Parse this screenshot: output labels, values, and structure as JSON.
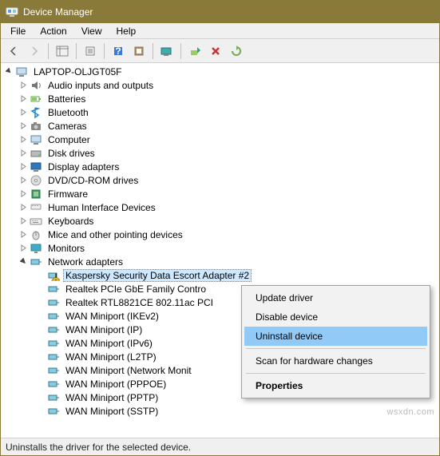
{
  "title": "Device Manager",
  "menus": {
    "file": "File",
    "action": "Action",
    "view": "View",
    "help": "Help"
  },
  "root": "LAPTOP-OLJGT05F",
  "cats": [
    "Audio inputs and outputs",
    "Batteries",
    "Bluetooth",
    "Cameras",
    "Computer",
    "Disk drives",
    "Display adapters",
    "DVD/CD-ROM drives",
    "Firmware",
    "Human Interface Devices",
    "Keyboards",
    "Mice and other pointing devices",
    "Monitors",
    "Network adapters"
  ],
  "net": {
    "selected": "Kaspersky Security Data Escort Adapter #2",
    "items": [
      "Realtek PCIe GbE Family Contro",
      "Realtek RTL8821CE 802.11ac PCI",
      "WAN Miniport (IKEv2)",
      "WAN Miniport (IP)",
      "WAN Miniport (IPv6)",
      "WAN Miniport (L2TP)",
      "WAN Miniport (Network Monit",
      "WAN Miniport (PPPOE)",
      "WAN Miniport (PPTP)",
      "WAN Miniport (SSTP)"
    ]
  },
  "ctx": {
    "update": "Update driver",
    "disable": "Disable device",
    "uninstall": "Uninstall device",
    "scan": "Scan for hardware changes",
    "props": "Properties"
  },
  "status": "Uninstalls the driver for the selected device.",
  "watermark": "wsxdn.com"
}
